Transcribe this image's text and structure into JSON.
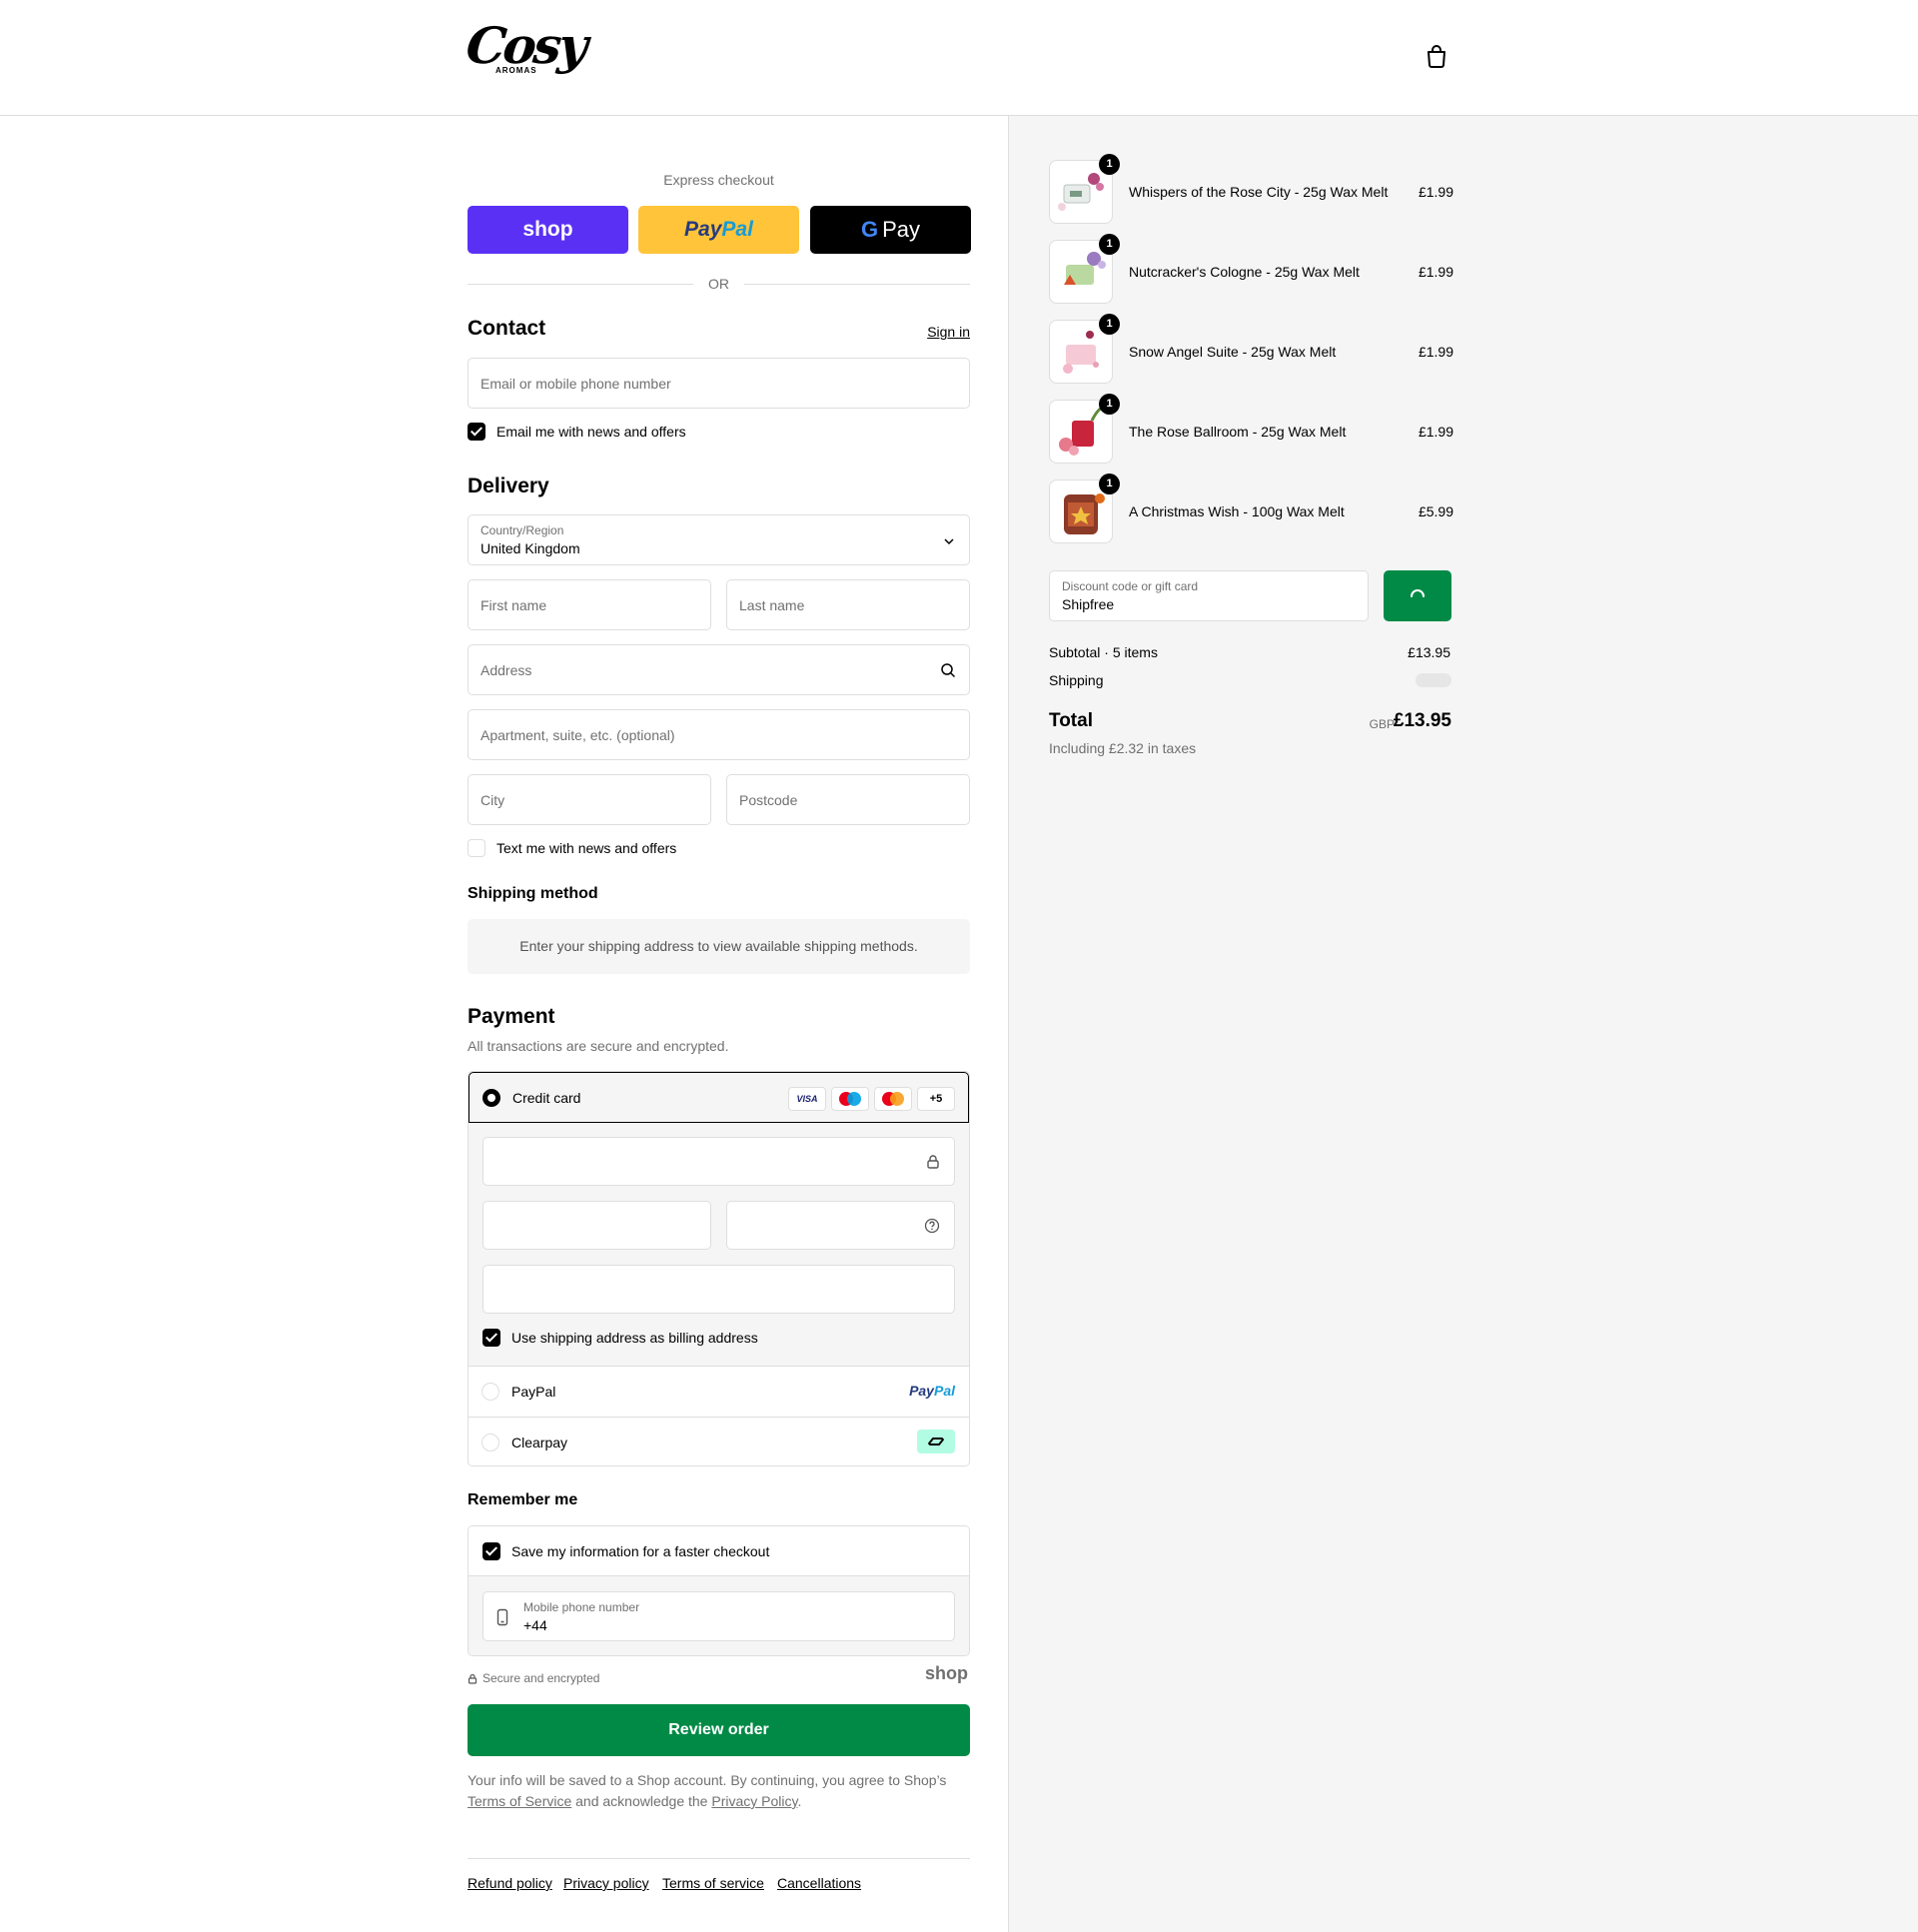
{
  "header": {
    "logo_text": "Cosy",
    "logo_subtext": "AROMAS",
    "cart_icon": "shopping-bag-icon"
  },
  "express": {
    "title": "Express checkout",
    "shop_label": "shop",
    "paypal_label_1": "Pay",
    "paypal_label_2": "Pal",
    "gpay_g": "G",
    "gpay_label": "Pay",
    "or": "OR"
  },
  "contact": {
    "heading": "Contact",
    "sign_in": "Sign in",
    "email_placeholder": "Email or mobile phone number",
    "news_label": "Email me with news and offers",
    "news_checked": true
  },
  "delivery": {
    "heading": "Delivery",
    "country_label": "Country/Region",
    "country_value": "United Kingdom",
    "first_name_placeholder": "First name",
    "last_name_placeholder": "Last name",
    "address_placeholder": "Address",
    "apartment_placeholder": "Apartment, suite, etc. (optional)",
    "city_placeholder": "City",
    "postcode_placeholder": "Postcode",
    "text_label": "Text me with news and offers",
    "text_checked": false
  },
  "shipping_method": {
    "heading": "Shipping method",
    "message": "Enter your shipping address to view available shipping methods."
  },
  "payment": {
    "heading": "Payment",
    "subtitle": "All transactions are secure and encrypted.",
    "credit_card_label": "Credit card",
    "card_brands": [
      "VISA",
      "Maestro",
      "Mastercard",
      "+5"
    ],
    "billing_label": "Use shipping address as billing address",
    "billing_checked": true,
    "paypal_label": "PayPal",
    "paypal_logo_1": "Pay",
    "paypal_logo_2": "Pal",
    "clearpay_label": "Clearpay"
  },
  "remember": {
    "heading": "Remember me",
    "save_label": "Save my information for a faster checkout",
    "save_checked": true,
    "phone_label": "Mobile phone number",
    "phone_value": "+44",
    "secure_text": "Secure and encrypted",
    "shop_logo": "shop"
  },
  "review_button": "Review order",
  "legal": {
    "text_1": "Your info will be saved to a Shop account. By continuing, you agree to Shop’s",
    "terms_link": "Terms of Service",
    "text_2": " and acknowledge the ",
    "privacy_link": "Privacy Policy",
    "text_3": "."
  },
  "footer_links": [
    "Refund policy",
    "Privacy policy",
    "Terms of service",
    "Cancellations"
  ],
  "summary": {
    "items": [
      {
        "name": "Whispers of the Rose City - 25g Wax Melt",
        "price": "£1.99",
        "qty": "1"
      },
      {
        "name": "Nutcracker's Cologne - 25g Wax Melt",
        "price": "£1.99",
        "qty": "1"
      },
      {
        "name": "Snow Angel Suite - 25g Wax Melt",
        "price": "£1.99",
        "qty": "1"
      },
      {
        "name": "The Rose Ballroom - 25g Wax Melt",
        "price": "£1.99",
        "qty": "1"
      },
      {
        "name": "A Christmas Wish - 100g Wax Melt",
        "price": "£5.99",
        "qty": "1"
      }
    ],
    "discount_label": "Discount code or gift card",
    "discount_value": "Shipfree",
    "subtotal_label": "Subtotal · 5 items",
    "subtotal_value": "£13.95",
    "shipping_label": "Shipping",
    "total_label": "Total",
    "currency": "GBP",
    "total_value": "£13.95",
    "taxes_note": "Including £2.32 in taxes"
  },
  "colors": {
    "shop_purple": "#5a31f4",
    "paypal_yellow": "#ffc439",
    "primary_green": "#008a46",
    "border": "#dedede"
  }
}
